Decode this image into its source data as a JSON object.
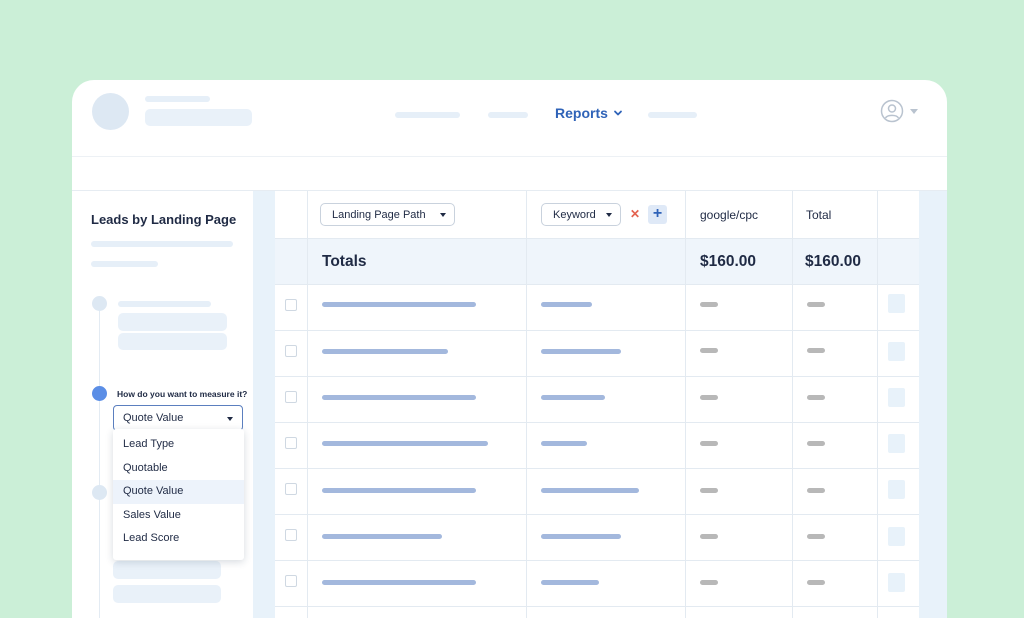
{
  "header": {
    "nav_reports_label": "Reports",
    "nav_reports_icon": "chevron-down-icon",
    "user_icon": "user-circle-icon"
  },
  "panel": {
    "title": "Leads by Landing Page",
    "measure_question": "How do you want to measure it?",
    "selected_measure": "Quote Value",
    "options": [
      "Lead Type",
      "Quotable",
      "Quote Value",
      "Sales Value",
      "Lead Score"
    ]
  },
  "table": {
    "dimension1": "Landing Page Path",
    "dimension2": "Keyword",
    "col_google": "google/cpc",
    "col_total": "Total",
    "totals_label": "Totals",
    "totals_google": "$160.00",
    "totals_total": "$160.00"
  },
  "colors": {
    "background": "#cbefd7",
    "accent": "#2f63b8",
    "remove": "#e4624f",
    "placeholder_bar": "#a3b8dd"
  }
}
